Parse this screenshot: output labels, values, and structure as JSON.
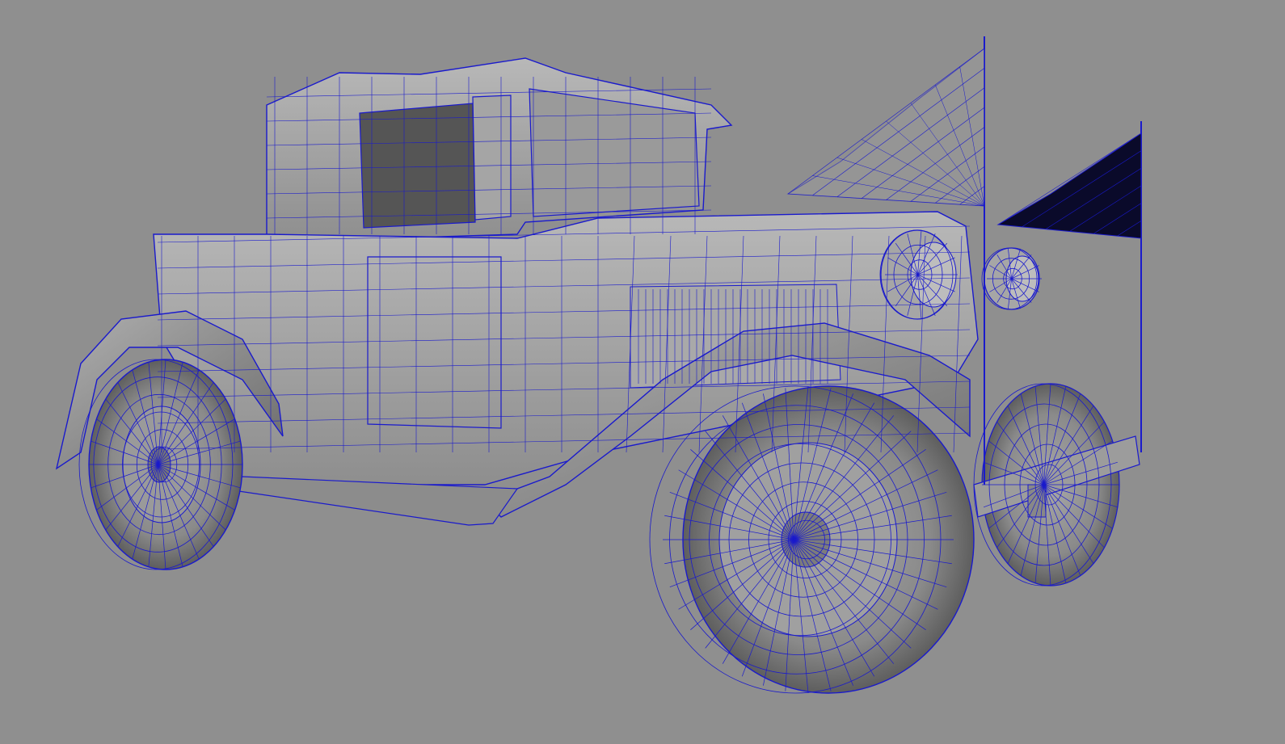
{
  "viewport": {
    "background_color": "#8f8f8f",
    "wireframe_color": "#1a1acc",
    "shade_light": "#b4b4b4",
    "shade_mid": "#9c9c9c",
    "shade_dark": "#6e6e6e",
    "flag_dark_color": "#0a0a2a"
  },
  "model": {
    "subject": "vintage-car-wireframe-mesh"
  }
}
